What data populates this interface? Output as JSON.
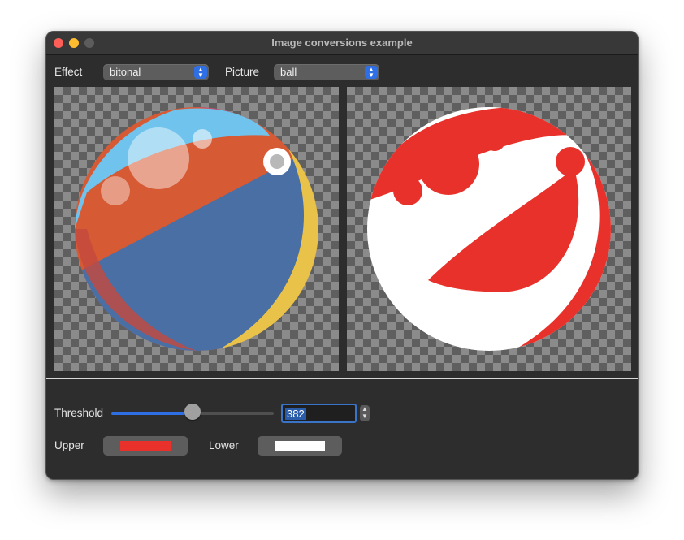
{
  "window": {
    "title": "Image conversions example"
  },
  "toolbar": {
    "effect_label": "Effect",
    "effect_value": "bitonal",
    "picture_label": "Picture",
    "picture_value": "ball"
  },
  "controls": {
    "threshold_label": "Threshold",
    "threshold_value": "382",
    "threshold_fraction": 0.5,
    "upper_label": "Upper",
    "upper_color": "#e8312a",
    "lower_label": "Lower",
    "lower_color": "#ffffff"
  },
  "icons": {
    "updown": "chevron-updown-icon"
  }
}
